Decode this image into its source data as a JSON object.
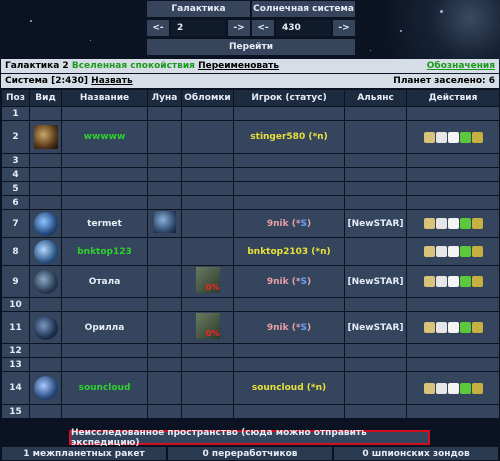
{
  "nav": {
    "galaxy_label": "Галактика",
    "system_label": "Солнечная система",
    "galaxy_prev": "<-",
    "galaxy_value": "2",
    "galaxy_next": "->",
    "system_prev": "<-",
    "system_value": "430",
    "system_next": "->",
    "go_button": "Перейти"
  },
  "galaxy_bar": {
    "title": "Галактика 2",
    "alliance_link": "Вселенная спокойствия",
    "rename_link": "Переименовать",
    "notations_link": "Обозначения"
  },
  "system_bar": {
    "system": "Система [2:430]",
    "back_link": "Назвать",
    "populated": "Планет заселено: 6"
  },
  "table": {
    "headers": [
      "Поз",
      "Вид",
      "Название",
      "Луна",
      "Обломки",
      "Игрок (статус)",
      "Альянс",
      "Действия"
    ],
    "rows": [
      {
        "pos": "1",
        "name": "",
        "player": "",
        "status": "",
        "ally": ""
      },
      {
        "pos": "2",
        "name": "wwwww",
        "player": "stinger580",
        "status": "(*n)",
        "ally": ""
      },
      {
        "pos": "3",
        "name": "",
        "player": "",
        "status": "",
        "ally": ""
      },
      {
        "pos": "4",
        "name": "",
        "player": "",
        "status": "",
        "ally": ""
      },
      {
        "pos": "5",
        "name": "",
        "player": "",
        "status": "",
        "ally": ""
      },
      {
        "pos": "6",
        "name": "",
        "player": "",
        "status": "",
        "ally": ""
      },
      {
        "pos": "7",
        "name": "termet",
        "player": "9nik",
        "status": "(*S)",
        "ally": "[NewSTAR]"
      },
      {
        "pos": "8",
        "name": "bnktop123",
        "player": "bnktop2103",
        "status": "(*n)",
        "ally": ""
      },
      {
        "pos": "9",
        "name": "Отала",
        "player": "9nik",
        "status": "(*S)",
        "ally": "[NewSTAR]",
        "debris": "0%"
      },
      {
        "pos": "10",
        "name": "",
        "player": "",
        "status": "",
        "ally": ""
      },
      {
        "pos": "11",
        "name": "Орилла",
        "player": "9nik",
        "status": "(*S)",
        "ally": "[NewSTAR]",
        "debris": "0%"
      },
      {
        "pos": "12",
        "name": "",
        "player": "",
        "status": "",
        "ally": ""
      },
      {
        "pos": "13",
        "name": "",
        "player": "",
        "status": "",
        "ally": ""
      },
      {
        "pos": "14",
        "name": "souncloud",
        "player": "souncloud",
        "status": "(*n)",
        "ally": ""
      },
      {
        "pos": "15",
        "name": "",
        "player": "",
        "status": "",
        "ally": ""
      }
    ]
  },
  "expedition": "Неисследованное пространство (сюда можно отправить экспедицию)",
  "footer": {
    "missiles": "1 межпланетных ракет",
    "recyclers": "0 переработчиков",
    "probes": "0 шпионских зондов"
  },
  "colors": {
    "player_self": "#e8e13a",
    "player_other": "#e9a0a8",
    "planet_green": "#2ed12e",
    "highlight_border": "#d01020"
  }
}
